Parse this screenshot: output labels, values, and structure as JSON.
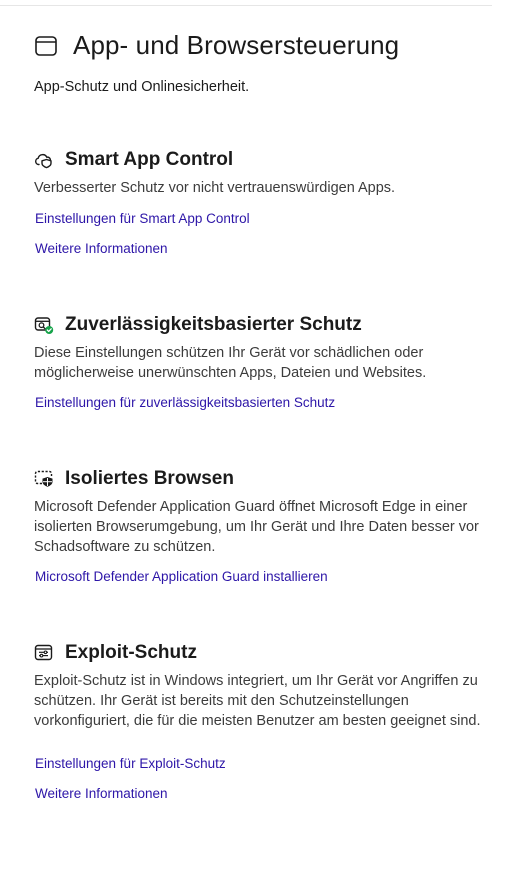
{
  "page": {
    "title": "App- und Browsersteuerung",
    "subtitle": "App-Schutz und Onlinesicherheit.",
    "icon": "browser-window-icon"
  },
  "sections": [
    {
      "icon": "cloud-shield-icon",
      "title": "Smart App Control",
      "description": "Verbesserter Schutz vor nicht vertrauenswürdigen Apps.",
      "links": [
        "Einstellungen für Smart App Control",
        "Weitere Informationen"
      ]
    },
    {
      "icon": "reputation-check-icon",
      "title": "Zuverlässigkeitsbasierter Schutz",
      "description": "Diese Einstellungen schützen Ihr Gerät vor schädlichen oder möglicherweise unerwünschten Apps, Dateien und Websites.",
      "links": [
        "Einstellungen für zuverlässigkeitsbasierten Schutz"
      ]
    },
    {
      "icon": "isolated-browsing-icon",
      "title": "Isoliertes Browsen",
      "description": "Microsoft Defender Application Guard öffnet Microsoft Edge in einer isolierten Browserumgebung, um Ihr Gerät und Ihre Daten besser vor Schadsoftware zu schützen.",
      "links": [
        "Microsoft Defender Application Guard installieren"
      ]
    },
    {
      "icon": "exploit-protection-icon",
      "title": "Exploit-Schutz",
      "description": "Exploit-Schutz ist in Windows integriert, um Ihr Gerät vor Angriffen zu schützen. Ihr Gerät ist bereits mit den Schutzeinstellungen vorkonfiguriert, die für die meisten Benutzer am besten geeignet sind.",
      "links": [
        "Einstellungen für Exploit-Schutz",
        "Weitere Informationen"
      ]
    }
  ],
  "colors": {
    "link": "#2d16a8",
    "check_badge": "#16a34a"
  }
}
